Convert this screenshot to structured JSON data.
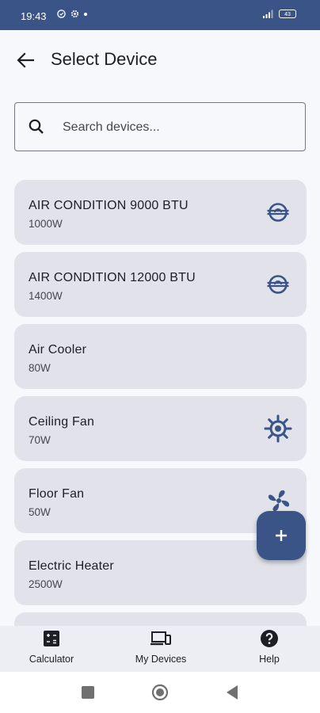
{
  "status_bar": {
    "time": "19:43",
    "battery": "43"
  },
  "app_bar": {
    "title": "Select Device"
  },
  "search": {
    "placeholder": "Search devices..."
  },
  "devices": [
    {
      "name": "AIR CONDITION 9000 BTU",
      "power": "1000W",
      "icon": "air-conditioner-icon"
    },
    {
      "name": "AIR CONDITION 12000 BTU",
      "power": "1400W",
      "icon": "air-conditioner-icon"
    },
    {
      "name": "Air Cooler",
      "power": "80W",
      "icon": ""
    },
    {
      "name": "Ceiling Fan",
      "power": "70W",
      "icon": "ceiling-fan-icon"
    },
    {
      "name": "Floor Fan",
      "power": "50W",
      "icon": "fan-icon"
    },
    {
      "name": "Electric Heater",
      "power": "2500W",
      "icon": ""
    }
  ],
  "fab": {
    "icon": "plus-icon"
  },
  "bottom_nav": {
    "items": [
      {
        "label": "Calculator",
        "icon": "calculator-icon"
      },
      {
        "label": "My Devices",
        "icon": "devices-icon"
      },
      {
        "label": "Help",
        "icon": "help-icon"
      }
    ]
  },
  "colors": {
    "primary": "#3b5488",
    "card": "#e2e2ea",
    "background": "#f7f8fb"
  }
}
